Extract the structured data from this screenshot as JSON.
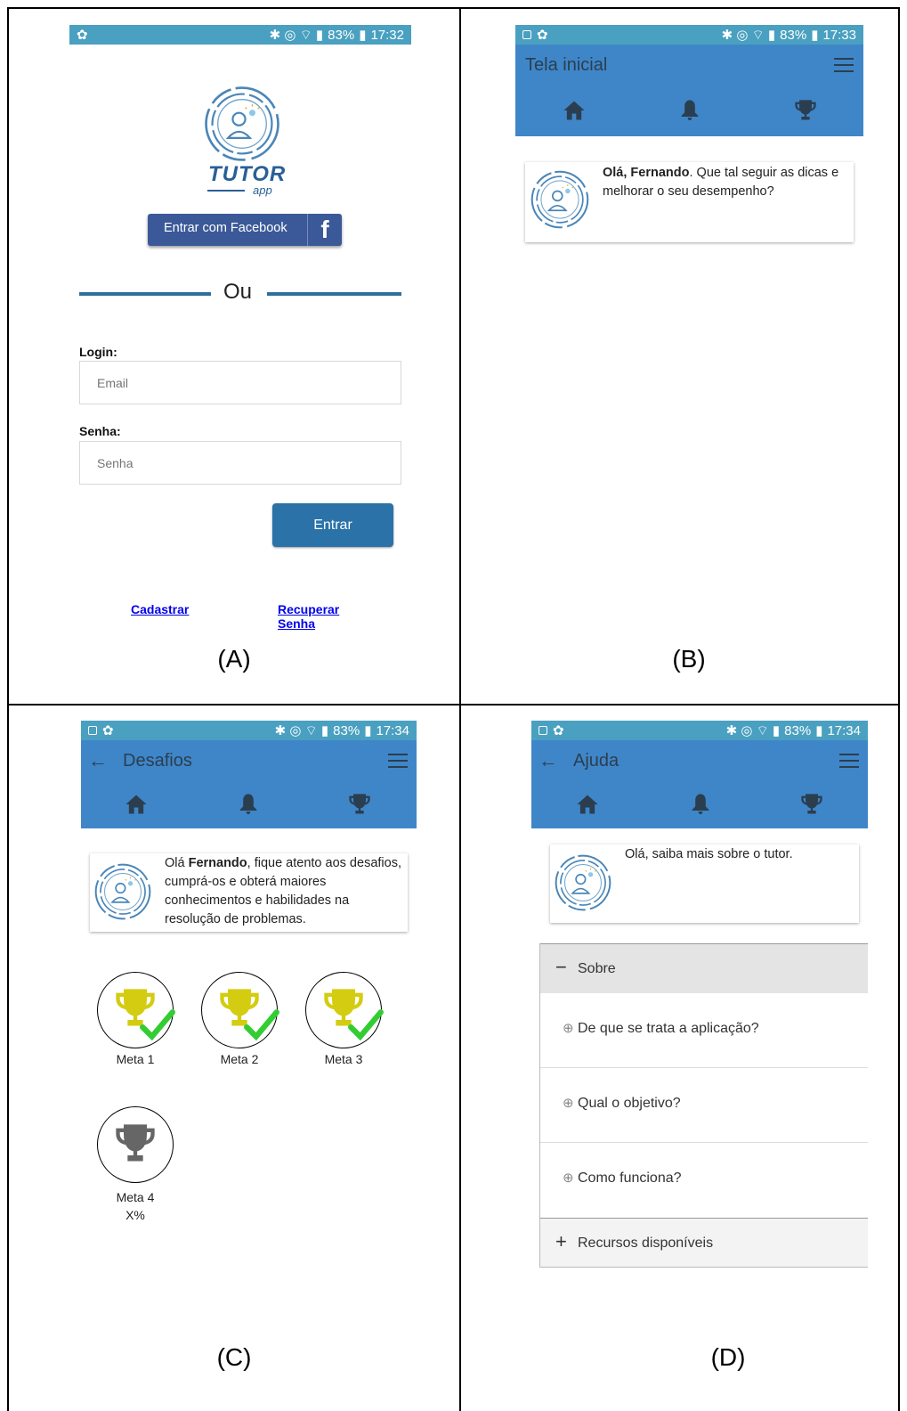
{
  "status": {
    "a": {
      "battery": "83%",
      "time": "17:32"
    },
    "b": {
      "battery": "83%",
      "time": "17:33"
    },
    "c": {
      "battery": "83%",
      "time": "17:34"
    },
    "d": {
      "battery": "83%",
      "time": "17:34"
    }
  },
  "panel_a": {
    "logo_text": "TUTOR",
    "logo_sub": "app",
    "facebook_button": "Entrar com Facebook",
    "divider_text": "Ou",
    "login_label": "Login:",
    "email_placeholder": "Email",
    "password_label": "Senha:",
    "password_placeholder": "Senha",
    "submit_button": "Entrar",
    "register_link": "Cadastrar",
    "recover_link": "Recuperar Senha",
    "caption": "(A)"
  },
  "panel_b": {
    "title": "Tela inicial",
    "greeting_name": "Olá, Fernando",
    "greeting_rest": ". Que tal seguir as dicas e melhorar o seu desempenho?",
    "caption": "(B)"
  },
  "panel_c": {
    "title": "Desafios",
    "greeting_prefix": "Olá ",
    "greeting_name": "Fernando",
    "greeting_rest": ", fique atento aos desafios, cumprá-os e obterá maiores conhecimentos e habilidades na resolução de problemas.",
    "goals": [
      {
        "label": "Meta 1",
        "completed": true
      },
      {
        "label": "Meta 2",
        "completed": true
      },
      {
        "label": "Meta 3",
        "completed": true
      },
      {
        "label": "Meta 4",
        "completed": false,
        "progress": "X%"
      }
    ],
    "caption": "(C)"
  },
  "panel_d": {
    "title": "Ajuda",
    "greeting": "Olá, saiba mais sobre o tutor.",
    "section_open": "Sobre",
    "items": [
      "De que se trata a aplicação?",
      "Qual o objetivo?",
      "Como funciona?"
    ],
    "section_closed": "Recursos disponíveis",
    "caption": "(D)"
  },
  "colors": {
    "appbar": "#3f86c8",
    "statusbar": "#4aa0c0",
    "primary_button": "#2a72a8",
    "facebook": "#3b5998",
    "trophy_gold": "#d4cc10",
    "check_green": "#33cc33",
    "trophy_gray": "#666666"
  },
  "icons": [
    "home-icon",
    "bell-icon",
    "trophy-icon",
    "menu-icon",
    "back-arrow-icon",
    "facebook-icon",
    "plus-circle-icon"
  ]
}
